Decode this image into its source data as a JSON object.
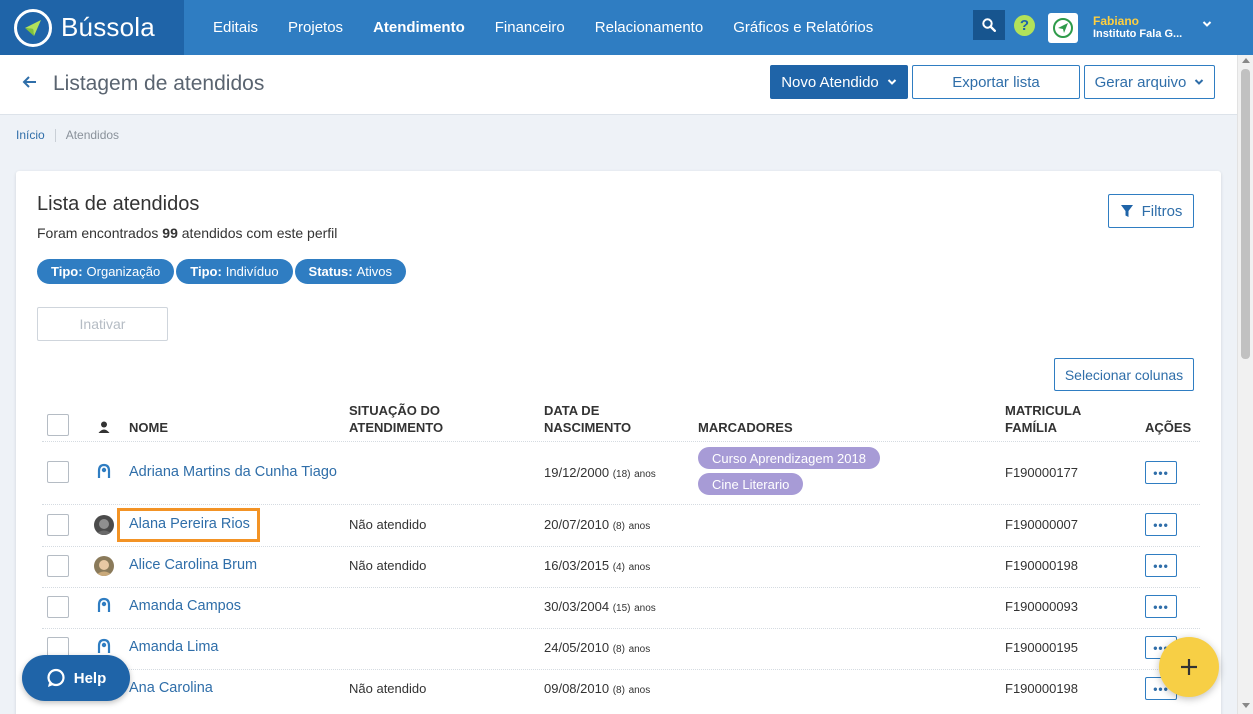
{
  "app": {
    "brand": "Bússola",
    "nav": [
      "Editais",
      "Projetos",
      "Atendimento",
      "Financeiro",
      "Relacionamento",
      "Gráficos e Relatórios"
    ],
    "active_nav": "Atendimento",
    "user_name": "Fabiano",
    "user_org": "Instituto Fala G...",
    "colors": {
      "brand": "#1f64a8",
      "nav": "#2f7dc2",
      "accent": "#f7cf45",
      "highlight": "#f39325",
      "tag": "#a79bd6"
    }
  },
  "header": {
    "title": "Listagem de atendidos",
    "new_button": "Novo Atendido",
    "export_button": "Exportar lista",
    "generate_button": "Gerar arquivo"
  },
  "breadcrumb": {
    "home": "Início",
    "current": "Atendidos"
  },
  "list": {
    "title": "Lista de atendidos",
    "summary_prefix": "Foram encontrados",
    "count": "99",
    "summary_suffix": "atendidos com este perfil",
    "filters_button": "Filtros",
    "chips": [
      {
        "key": "Tipo:",
        "value": "Organização"
      },
      {
        "key": "Tipo:",
        "value": "Indivíduo"
      },
      {
        "key": "Status:",
        "value": "Ativos"
      }
    ],
    "inactivate_button": "Inativar",
    "select_columns_button": "Selecionar colunas",
    "columns": {
      "name": "NOME",
      "situation_1": "SITUAÇÃO DO",
      "situation_2": "ATENDIMENTO",
      "birth_1": "DATA DE",
      "birth_2": "NASCIMENTO",
      "markers": "MARCADORES",
      "reg_1": "MATRICULA",
      "reg_2": "FAMÍLIA",
      "actions": "AÇÕES"
    },
    "rows": [
      {
        "name": "Adriana Martins da Cunha Tiago",
        "situation": "",
        "birth": "19/12/2000",
        "age": "(18)",
        "reg": "F190000177",
        "markers": [
          "Curso Aprendizagem 2018",
          "Cine Literario"
        ],
        "avatar": "person-icon"
      },
      {
        "name": "Alana Pereira Rios",
        "situation": "Não atendido",
        "birth": "20/07/2010",
        "age": "(8)",
        "reg": "F190000007",
        "markers": [],
        "avatar": "photo"
      },
      {
        "name": "Alice Carolina Brum",
        "situation": "Não atendido",
        "birth": "16/03/2015",
        "age": "(4)",
        "reg": "F190000198",
        "markers": [],
        "avatar": "photo"
      },
      {
        "name": "Amanda Campos",
        "situation": "",
        "birth": "30/03/2004",
        "age": "(15)",
        "reg": "F190000093",
        "markers": [],
        "avatar": "person-icon"
      },
      {
        "name": "Amanda Lima",
        "situation": "",
        "birth": "24/05/2010",
        "age": "(8)",
        "reg": "F190000195",
        "markers": [],
        "avatar": "person-icon"
      },
      {
        "name": "Ana Carolina",
        "situation": "Não atendido",
        "birth": "09/08/2010",
        "age": "(8)",
        "reg": "F190000198",
        "markers": [],
        "avatar": "person-icon"
      }
    ],
    "age_unit": "anos",
    "action_dots": "•••"
  },
  "help": {
    "label": "Help"
  }
}
